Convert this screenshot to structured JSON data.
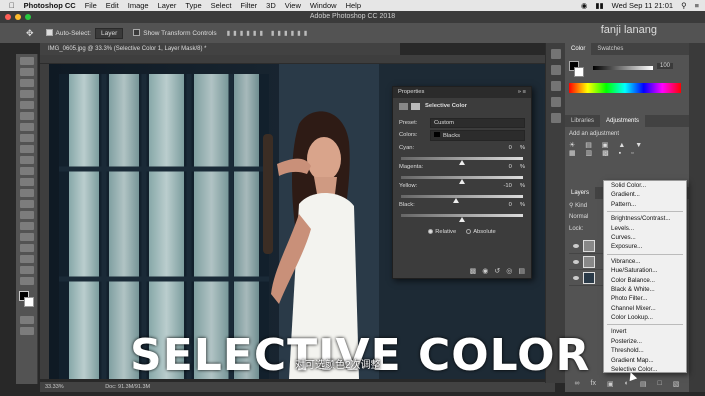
{
  "menubar": {
    "app_name": "Photoshop CC",
    "items": [
      "File",
      "Edit",
      "Image",
      "Layer",
      "Type",
      "Select",
      "Filter",
      "3D",
      "View",
      "Window",
      "Help"
    ],
    "clock": "Wed Sep 11  21:01"
  },
  "window": {
    "title": "Adobe Photoshop CC 2018"
  },
  "options_bar": {
    "auto_select_label": "Auto-Select:",
    "auto_select_value": "Layer",
    "transform_label": "Show Transform Controls",
    "workspace": "fanji lanang"
  },
  "document": {
    "tab_title": "IMG_0605.jpg @ 33.3% (Selective Color 1, Layer Mask/8) *",
    "zoom": "33.33%",
    "doc_size": "Doc: 91.3M/91.3M"
  },
  "properties": {
    "panel_title": "Properties",
    "adjustment_name": "Selective Color",
    "preset_label": "Preset:",
    "preset_value": "Custom",
    "colors_label": "Colors:",
    "colors_value": "Blacks",
    "sliders": [
      {
        "label": "Cyan:",
        "value": "0",
        "unit": "%",
        "level": 0.5
      },
      {
        "label": "Magenta:",
        "value": "0",
        "unit": "%",
        "level": 0.5
      },
      {
        "label": "Yellow:",
        "value": "-10",
        "unit": "%",
        "level": 0.45
      },
      {
        "label": "Black:",
        "value": "0",
        "unit": "%",
        "level": 0.5
      }
    ],
    "relative_label": "Relative",
    "absolute_label": "Absolute"
  },
  "right_panel": {
    "color_tabs": [
      "Color",
      "Swatches"
    ],
    "brightness_value": "100",
    "lib_tabs": [
      "Libraries",
      "Adjustments"
    ],
    "add_adjustment": "Add an adjustment",
    "layers_tab": "Layers",
    "kind_label": "Kind",
    "blend_mode": "Normal",
    "lock_label": "Lock:"
  },
  "adjustment_menu": {
    "groups": [
      [
        "Solid Color...",
        "Gradient...",
        "Pattern..."
      ],
      [
        "Brightness/Contrast...",
        "Levels...",
        "Curves...",
        "Exposure..."
      ],
      [
        "Vibrance...",
        "Hue/Saturation...",
        "Color Balance...",
        "Black & White...",
        "Photo Filter...",
        "Channel Mixer...",
        "Color Lookup..."
      ],
      [
        "Invert",
        "Posterize...",
        "Threshold...",
        "Gradient Map...",
        "Selective Color..."
      ]
    ]
  },
  "overlay": {
    "title": "SELECTIVE COLOR",
    "subtitle": "对可选颜色2次调整"
  }
}
